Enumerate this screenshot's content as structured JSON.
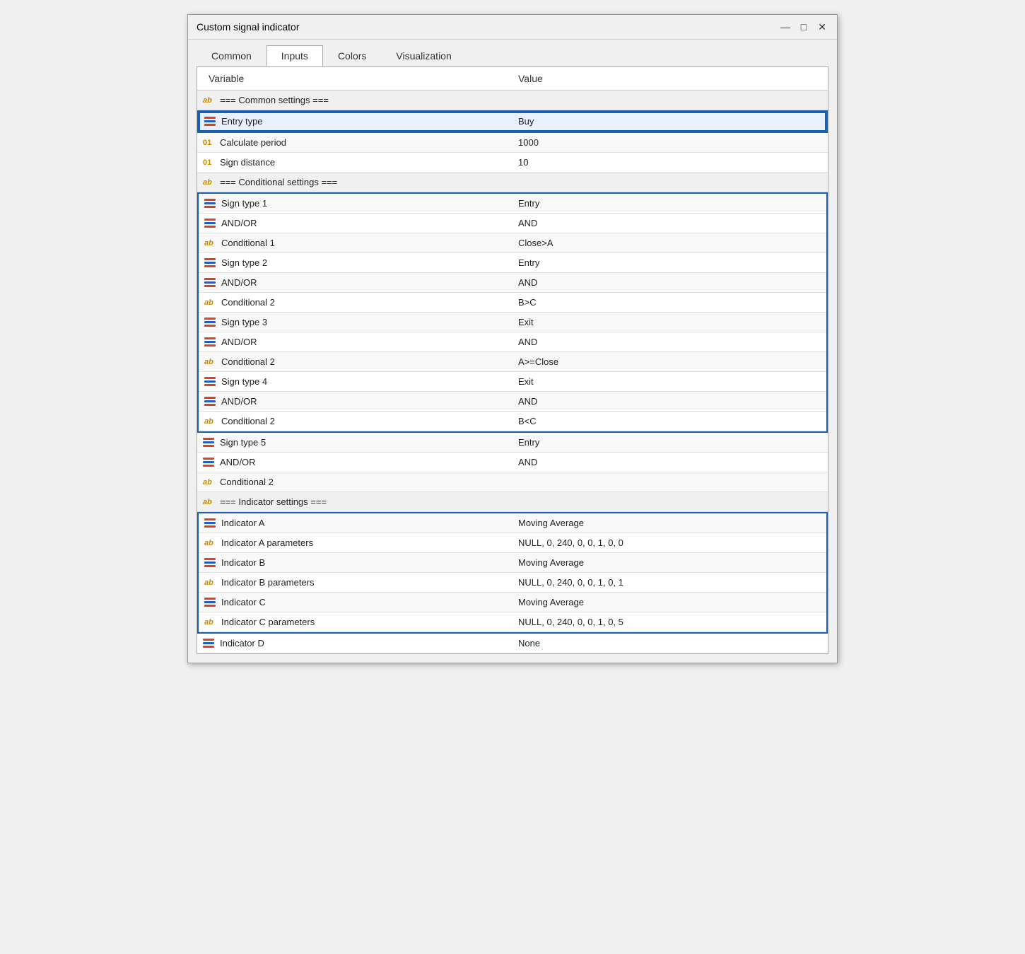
{
  "window": {
    "title": "Custom signal indicator",
    "controls": {
      "minimize": "—",
      "maximize": "□",
      "close": "✕"
    }
  },
  "tabs": [
    {
      "id": "common",
      "label": "Common",
      "active": false
    },
    {
      "id": "inputs",
      "label": "Inputs",
      "active": true
    },
    {
      "id": "colors",
      "label": "Colors",
      "active": false
    },
    {
      "id": "visualization",
      "label": "Visualization",
      "active": false
    }
  ],
  "table": {
    "headers": [
      "Variable",
      "Value"
    ],
    "rows": [
      {
        "icon": "ab",
        "variable": "=== Common settings ===",
        "value": "",
        "section_header": true,
        "group": "none"
      },
      {
        "icon": "lines",
        "variable": "Entry type",
        "value": "Buy",
        "selected": true,
        "group": "entry"
      },
      {
        "icon": "01",
        "variable": "Calculate period",
        "value": "1000",
        "group": "none"
      },
      {
        "icon": "01",
        "variable": "Sign distance",
        "value": "10",
        "group": "none"
      },
      {
        "icon": "ab",
        "variable": "=== Conditional settings ===",
        "value": "",
        "section_header": true,
        "group": "none"
      },
      {
        "icon": "lines",
        "variable": "Sign type 1",
        "value": "Entry",
        "group": "conditional"
      },
      {
        "icon": "lines",
        "variable": "AND/OR",
        "value": "AND",
        "group": "conditional"
      },
      {
        "icon": "ab",
        "variable": "Conditional 1",
        "value": "Close>A",
        "group": "conditional"
      },
      {
        "icon": "lines",
        "variable": "Sign type 2",
        "value": "Entry",
        "group": "conditional"
      },
      {
        "icon": "lines",
        "variable": "AND/OR",
        "value": "AND",
        "group": "conditional"
      },
      {
        "icon": "ab",
        "variable": "Conditional 2",
        "value": "B>C",
        "group": "conditional"
      },
      {
        "icon": "lines",
        "variable": "Sign type 3",
        "value": "Exit",
        "group": "conditional"
      },
      {
        "icon": "lines",
        "variable": "AND/OR",
        "value": "AND",
        "group": "conditional"
      },
      {
        "icon": "ab",
        "variable": "Conditional 2",
        "value": "A>=Close",
        "group": "conditional"
      },
      {
        "icon": "lines",
        "variable": "Sign type 4",
        "value": "Exit",
        "group": "conditional"
      },
      {
        "icon": "lines",
        "variable": "AND/OR",
        "value": "AND",
        "group": "conditional"
      },
      {
        "icon": "ab",
        "variable": "Conditional 2",
        "value": "B<C",
        "group": "conditional"
      },
      {
        "icon": "lines",
        "variable": "Sign type 5",
        "value": "Entry",
        "group": "none"
      },
      {
        "icon": "lines",
        "variable": "AND/OR",
        "value": "AND",
        "group": "none"
      },
      {
        "icon": "ab",
        "variable": "Conditional 2",
        "value": "",
        "group": "none"
      },
      {
        "icon": "ab",
        "variable": "=== Indicator settings ===",
        "value": "",
        "section_header": true,
        "group": "none"
      },
      {
        "icon": "lines",
        "variable": "Indicator A",
        "value": "Moving Average",
        "group": "indicator"
      },
      {
        "icon": "ab",
        "variable": "Indicator A parameters",
        "value": "NULL, 0, 240, 0, 0, 1, 0, 0",
        "group": "indicator"
      },
      {
        "icon": "lines",
        "variable": "Indicator B",
        "value": "Moving Average",
        "group": "indicator"
      },
      {
        "icon": "ab",
        "variable": "Indicator B parameters",
        "value": "NULL, 0, 240, 0, 0, 1, 0, 1",
        "group": "indicator"
      },
      {
        "icon": "lines",
        "variable": "Indicator C",
        "value": "Moving Average",
        "group": "indicator"
      },
      {
        "icon": "ab",
        "variable": "Indicator C parameters",
        "value": "NULL, 0, 240, 0, 0, 1, 0, 5",
        "group": "indicator"
      },
      {
        "icon": "lines",
        "variable": "Indicator D",
        "value": "None",
        "group": "none"
      }
    ]
  }
}
